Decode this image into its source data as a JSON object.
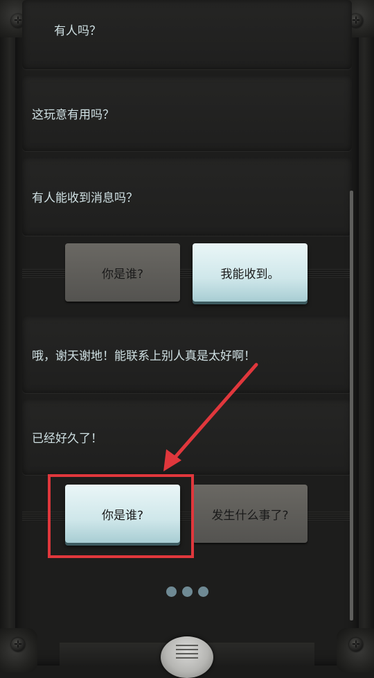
{
  "messages": [
    {
      "text": "有人吗？"
    },
    {
      "text": "这玩意有用吗？"
    },
    {
      "text": "有人能收到消息吗？"
    },
    {
      "text": "哦，谢天谢地！能联系上别人真是太好啊！"
    },
    {
      "text": "已经好久了！"
    }
  ],
  "choices_1": {
    "left": "你是谁?",
    "right": "我能收到。"
  },
  "choices_2": {
    "left": "你是谁?",
    "right": "发生什么事了?"
  },
  "colors": {
    "highlight": "#e0373c",
    "lit_button": "#cfe7ea",
    "dim_button": "#5e5d59",
    "text": "#cfe0e3"
  },
  "icons": {
    "menu": "hamburger-knob-icon",
    "screws": "screw-icon",
    "typing": "typing-dots-icon"
  }
}
